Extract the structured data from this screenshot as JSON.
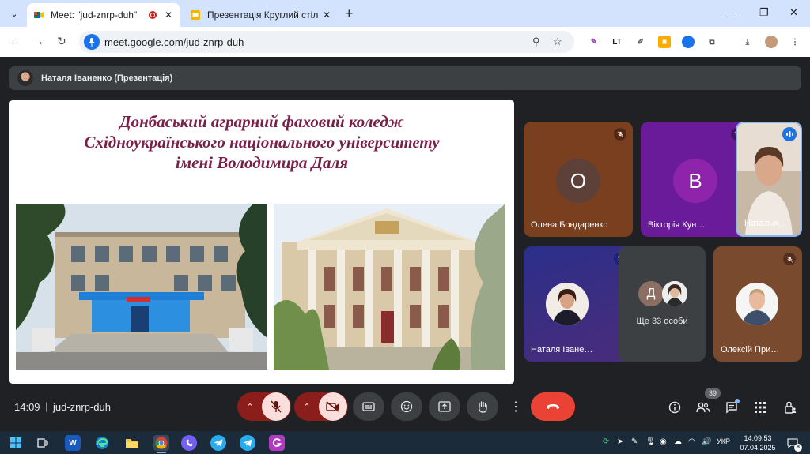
{
  "browser": {
    "tabs": [
      {
        "title": "Meet: \"jud-znrp-duh\"",
        "active": true
      },
      {
        "title": "Презентація Круглий стіл «Мо",
        "active": false
      }
    ],
    "url": "meet.google.com/jud-znrp-duh"
  },
  "meet": {
    "presenter_label": "Наталя Іваненко (Презентація)",
    "slide": {
      "title_lines": [
        "Донбаський аграрний фаховий коледж",
        "Східноукраїнського національного університету",
        "імені Володимира Даля"
      ]
    },
    "participants": [
      {
        "initial": "О",
        "name": "Олена Бондаренко",
        "color": "#5d4037"
      },
      {
        "initial": "В",
        "name": "Вікторія Кун…",
        "color": "#8e24aa"
      },
      {
        "name": "Наталья…"
      },
      {
        "name": "Наталя Іване…"
      },
      {
        "initials": [
          "Д"
        ],
        "name": "Ще 33 особи"
      },
      {
        "name": "Олексій При…"
      }
    ],
    "time": "14:09",
    "separator": "|",
    "meeting_code": "jud-znrp-duh",
    "participant_count": "39"
  },
  "taskbar": {
    "language": "УКР",
    "clock_time": "14:09:53",
    "clock_date": "07.04.2025",
    "notification_count": "8",
    "word_label": "W"
  },
  "colors": {
    "meet_bg": "#202124",
    "end_call": "#ea4335",
    "muted_control": "#8b1d1a",
    "slide_title": "#7a1f4a"
  }
}
